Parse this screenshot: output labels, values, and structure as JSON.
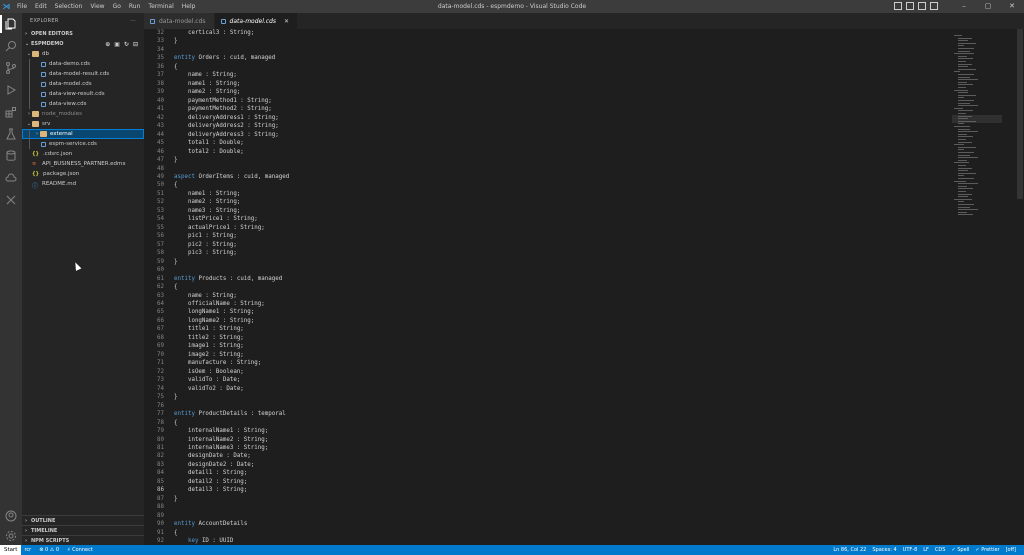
{
  "titlebar": {
    "menu": [
      "File",
      "Edit",
      "Selection",
      "View",
      "Go",
      "Run",
      "Terminal",
      "Help"
    ],
    "title": "data-model.cds - espmdemo - Visual Studio Code",
    "controls": [
      "–",
      "▢",
      "✕"
    ]
  },
  "activity_icons": [
    "files-icon",
    "search-icon",
    "source-control-icon",
    "run-debug-icon",
    "extensions-icon",
    "testing-icon",
    "database-icon",
    "cloud-icon",
    "tools-icon"
  ],
  "sidebar": {
    "title": "EXPLORER",
    "more": "···",
    "open_editors": "OPEN EDITORS",
    "project": "ESPMDEMO",
    "tree": [
      {
        "label": "db",
        "type": "folder",
        "depth": 0,
        "open": true
      },
      {
        "label": "data-demo.cds",
        "type": "cds",
        "depth": 1
      },
      {
        "label": "data-model-result.cds",
        "type": "cds",
        "depth": 1
      },
      {
        "label": "data-model.cds",
        "type": "cds",
        "depth": 1
      },
      {
        "label": "data-view-result.cds",
        "type": "cds",
        "depth": 1
      },
      {
        "label": "data-view.cds",
        "type": "cds",
        "depth": 1
      },
      {
        "label": "node_modules",
        "type": "folder",
        "depth": 0,
        "open": false,
        "dim": true
      },
      {
        "label": "srv",
        "type": "folder",
        "depth": 0,
        "open": true
      },
      {
        "label": "external",
        "type": "folder",
        "depth": 1,
        "open": false,
        "selected": true
      },
      {
        "label": "espm-service.cds",
        "type": "cds",
        "depth": 1
      },
      {
        "label": ".cdsrc.json",
        "type": "json",
        "depth": 0
      },
      {
        "label": "API_BUSINESS_PARTNER.edmx",
        "type": "xml",
        "depth": 0
      },
      {
        "label": "package.json",
        "type": "json",
        "depth": 0
      },
      {
        "label": "README.md",
        "type": "info",
        "depth": 0
      }
    ],
    "outline": "OUTLINE",
    "timeline": "TIMELINE",
    "npm_scripts": "NPM SCRIPTS"
  },
  "tabs": [
    {
      "label": "data-model.cds",
      "active": false
    },
    {
      "label": "data-model.cds",
      "active": true,
      "close": "✕"
    }
  ],
  "code": [
    {
      "n": "32",
      "t": "    certical3 : String;"
    },
    {
      "n": "33",
      "t": "}"
    },
    {
      "n": "34",
      "t": ""
    },
    {
      "n": "35",
      "kw": "entity",
      "t": " Orders : cuid, managed"
    },
    {
      "n": "36",
      "t": "{"
    },
    {
      "n": "37",
      "t": "    name : String;"
    },
    {
      "n": "38",
      "t": "    name1 : String;"
    },
    {
      "n": "39",
      "t": "    name2 : String;"
    },
    {
      "n": "40",
      "t": "    paymentMethod1 : String;"
    },
    {
      "n": "41",
      "t": "    paymentMethod2 : String;"
    },
    {
      "n": "42",
      "t": "    deliveryAddress1 : String;"
    },
    {
      "n": "43",
      "t": "    deliveryAddress2 : String;"
    },
    {
      "n": "44",
      "t": "    deliveryAddress3 : String;"
    },
    {
      "n": "45",
      "t": "    total1 : Double;"
    },
    {
      "n": "46",
      "t": "    total2 : Double;"
    },
    {
      "n": "47",
      "t": "}"
    },
    {
      "n": "48",
      "t": ""
    },
    {
      "n": "49",
      "kw": "aspect",
      "t": " OrderItems : cuid, managed"
    },
    {
      "n": "50",
      "t": "{"
    },
    {
      "n": "51",
      "t": "    name1 : String;"
    },
    {
      "n": "52",
      "t": "    name2 : String;"
    },
    {
      "n": "53",
      "t": "    name3 : String;"
    },
    {
      "n": "54",
      "t": "    listPrice1 : String;"
    },
    {
      "n": "55",
      "t": "    actualPrice1 : String;"
    },
    {
      "n": "56",
      "t": "    pic1 : String;"
    },
    {
      "n": "57",
      "t": "    pic2 : String;"
    },
    {
      "n": "58",
      "t": "    pic3 : String;"
    },
    {
      "n": "59",
      "t": "}"
    },
    {
      "n": "60",
      "t": ""
    },
    {
      "n": "61",
      "kw": "entity",
      "t": " Products : cuid, managed"
    },
    {
      "n": "62",
      "t": "{"
    },
    {
      "n": "63",
      "t": "    name : String;"
    },
    {
      "n": "64",
      "t": "    officialName : String;"
    },
    {
      "n": "65",
      "t": "    longName1 : String;"
    },
    {
      "n": "66",
      "t": "    longName2 : String;"
    },
    {
      "n": "67",
      "t": "    title1 : String;"
    },
    {
      "n": "68",
      "t": "    title2 : String;"
    },
    {
      "n": "69",
      "t": "    image1 : String;"
    },
    {
      "n": "70",
      "t": "    image2 : String;"
    },
    {
      "n": "71",
      "t": "    manufacture : String;"
    },
    {
      "n": "72",
      "t": "    isOem : Boolean;"
    },
    {
      "n": "73",
      "t": "    validTo : Date;"
    },
    {
      "n": "74",
      "t": "    validTo2 : Date;"
    },
    {
      "n": "75",
      "t": "}"
    },
    {
      "n": "76",
      "t": ""
    },
    {
      "n": "77",
      "kw": "entity",
      "t": " ProductDetails : temporal"
    },
    {
      "n": "78",
      "t": "{"
    },
    {
      "n": "79",
      "t": "    internalName1 : String;"
    },
    {
      "n": "80",
      "t": "    internalName2 : String;"
    },
    {
      "n": "81",
      "t": "    internalName3 : String;"
    },
    {
      "n": "82",
      "t": "    designDate : Date;"
    },
    {
      "n": "83",
      "t": "    designDate2 : Date;"
    },
    {
      "n": "84",
      "t": "    detail1 : String;"
    },
    {
      "n": "85",
      "t": "    detail2 : String;"
    },
    {
      "n": "86",
      "t": "    detail3 : String;",
      "current": true
    },
    {
      "n": "87",
      "t": "}"
    },
    {
      "n": "88",
      "t": ""
    },
    {
      "n": "89",
      "t": ""
    },
    {
      "n": "90",
      "kw": "entity",
      "t": " AccountDetails"
    },
    {
      "n": "91",
      "t": "{"
    },
    {
      "n": "92",
      "t": "    ",
      "kw2": "key",
      "t2": " ID : UUID"
    }
  ],
  "statusbar": {
    "start": "Start",
    "branch": "rcr",
    "problems": "⊗ 0 ⚠ 0",
    "connect": "⚡ Connect",
    "right": [
      "Ln 86, Col 22",
      "Spaces: 4",
      "UTF-8",
      "LF",
      "CDS",
      "✓ Spell",
      "✓ Prettier",
      "[off]"
    ]
  },
  "colors": {
    "accent": "#007acc",
    "keyword": "#569cd6",
    "folder": "#dcb67a"
  }
}
